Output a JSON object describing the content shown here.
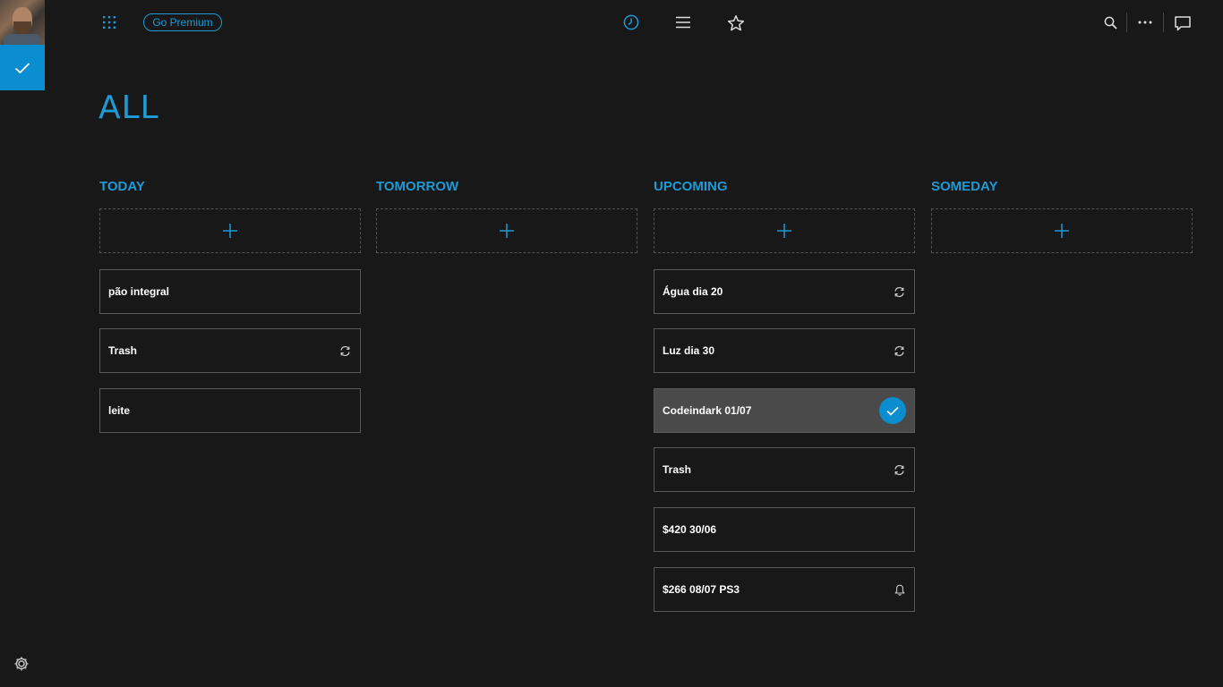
{
  "topbar": {
    "premium_label": "Go Premium"
  },
  "page": {
    "title": "ALL"
  },
  "colors": {
    "accent": "#1e9ad6",
    "background": "#181818",
    "task_border": "#5a5a5a",
    "done_task_bg": "#4a4a4a"
  },
  "columns": [
    {
      "title": "TODAY",
      "tasks": [
        {
          "label": "pão integral",
          "icon": ""
        },
        {
          "label": "Trash",
          "icon": "repeat-icon"
        },
        {
          "label": "leite",
          "icon": ""
        }
      ]
    },
    {
      "title": "TOMORROW",
      "tasks": []
    },
    {
      "title": "UPCOMING",
      "tasks": [
        {
          "label": "Água dia 20",
          "icon": "repeat-icon"
        },
        {
          "label": "Luz dia 30",
          "icon": "repeat-icon"
        },
        {
          "label": "Codeindark 01/07",
          "icon": "check-icon",
          "state": "selected"
        },
        {
          "label": "Trash",
          "icon": "repeat-icon"
        },
        {
          "label": "$420 30/06",
          "icon": ""
        },
        {
          "label": "$266 08/07 PS3",
          "icon": "bell-icon"
        }
      ]
    },
    {
      "title": "SOMEDAY",
      "tasks": []
    }
  ]
}
